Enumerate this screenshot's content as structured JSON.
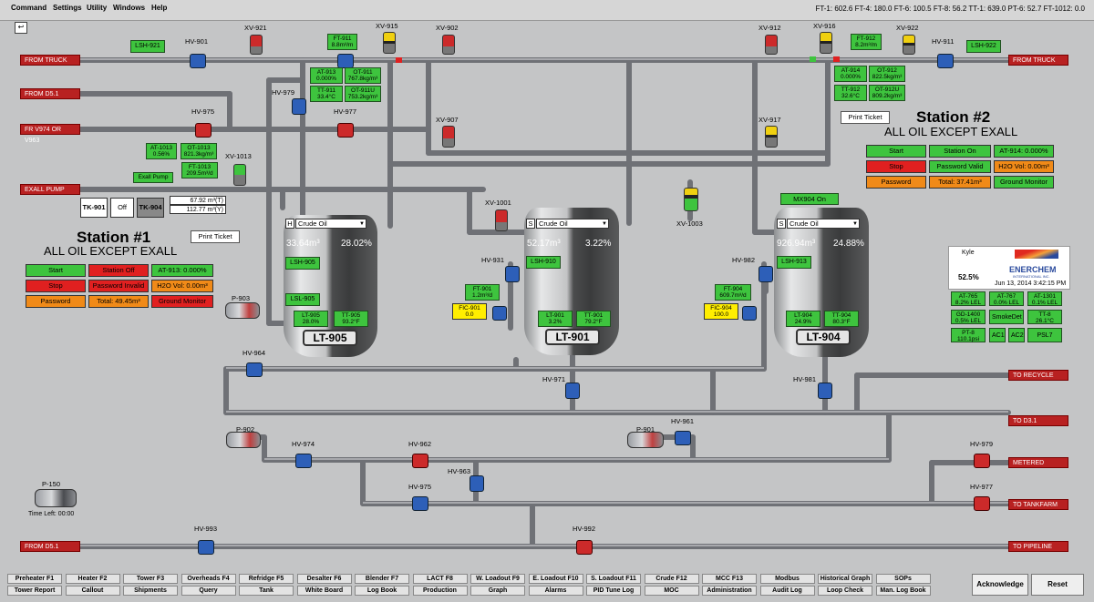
{
  "menu": [
    "Command",
    "Settings",
    "Utility",
    "Windows",
    "Help"
  ],
  "status_readout": "FT-1: 602.6  FT-4: 180.0  FT-6: 100.5  FT-8: 56.2  TT-1: 639.0  PT-6: 52.7  FT-1012: 0.0",
  "lines": {
    "from_truck_left": "FROM TRUCK",
    "from_d51_top": "FROM D5.1",
    "fr_v974": "FR V974 OR V963",
    "exall_pump": "EXALL PUMP",
    "from_truck_right": "FROM TRUCK",
    "to_recycle": "TO RECYCLE",
    "to_d31": "TO D3.1",
    "metered": "METERED",
    "to_tankfarm": "TO TANKFARM",
    "to_pipeline": "TO PIPELINE",
    "from_d51_bottom": "FROM D5.1"
  },
  "valves": {
    "hv901": "HV-901",
    "xv921": "XV-921",
    "xv915": "XV-915",
    "xv902": "XV-902",
    "xv912": "XV-912",
    "xv916": "XV-916",
    "xv922": "XV-922",
    "hv911": "HV-911",
    "hv975a": "HV-975",
    "hv977a": "HV-977",
    "hv979a": "HV-979",
    "xv907": "XV-907",
    "xv917": "XV-917",
    "xv1013": "XV-1013",
    "xv1001": "XV-1001",
    "xv1003": "XV-1003",
    "hv931": "HV-931",
    "hv982": "HV-982",
    "hv964": "HV-964",
    "hv971": "HV-971",
    "hv981": "HV-981",
    "hv974": "HV-974",
    "hv962": "HV-962",
    "hv963": "HV-963",
    "hv975b": "HV-975",
    "hv961": "HV-961",
    "hv979b": "HV-979",
    "hv977b": "HV-977",
    "hv993": "HV-993",
    "hv992": "HV-992"
  },
  "pumps": {
    "p903": "P-903",
    "p902": "P-902",
    "p901": "P-901",
    "p150": "P-150"
  },
  "tags": {
    "lsh921": "LSH-921",
    "ft911": [
      "FT-911",
      "8.8m³/m"
    ],
    "at913": [
      "AT-913",
      "0.000%"
    ],
    "ot911": [
      "OT-911",
      "767.8kg/m³"
    ],
    "tt911": [
      "TT-911",
      "33.4°C"
    ],
    "ot911u": [
      "OT-911U",
      "753.2kg/m³"
    ],
    "ft912": [
      "FT-912",
      "8.2m³/m"
    ],
    "lsh922": "LSH-922",
    "at914": [
      "AT-914",
      "0.000%"
    ],
    "ot912": [
      "OT-912",
      "822.5kg/m³"
    ],
    "tt912": [
      "TT-912",
      "32.6°C"
    ],
    "ot912u": [
      "OT-912U",
      "809.2kg/m³"
    ],
    "at1013": [
      "AT-1013",
      "0.56%"
    ],
    "ot1013": [
      "OT-1013",
      "821.3kg/m³"
    ],
    "ft1013": [
      "FT-1013",
      "209.5m³/d"
    ],
    "exall_pump_btn": "Exall Pump",
    "ft1013_t": "67.92 m³(T)",
    "ft1013_y": "112.77 m³(Y)",
    "lsh905": "LSH-905",
    "lsl905": "LSL-905",
    "lt905": [
      "LT-905",
      "28.0%"
    ],
    "tt905": [
      "TT-905",
      "93.2°F"
    ],
    "lsh910": "LSH-910",
    "ft901": [
      "FT-901",
      "1.2m³/d"
    ],
    "fic901": [
      "FIC-901",
      "0.0"
    ],
    "lt901": [
      "LT-901",
      "3.2%"
    ],
    "tt901": [
      "TT-901",
      "79.2°F"
    ],
    "lsh913": "LSH-913",
    "ft904": [
      "FT-904",
      "609.7m³/d"
    ],
    "fic904": [
      "FIC-904",
      "100.0"
    ],
    "lt904": [
      "LT-904",
      "24.9%"
    ],
    "tt904": [
      "TT-904",
      "80.3°F"
    ]
  },
  "station1": {
    "title": "Station #1",
    "subtitle": "ALL OIL EXCEPT EXALL",
    "tk901": "TK-901",
    "off": "Off",
    "tk904": "TK-904",
    "print": "Print Ticket",
    "start": "Start",
    "station_off": "Station Off",
    "at913": "AT-913: 0.000%",
    "stop": "Stop",
    "password_invalid": "Password Invalid",
    "h2o": "H2O Vol: 0.00m³",
    "password": "Password",
    "total": "Total: 49.45m³",
    "ground_monitor": "Ground Monitor"
  },
  "station2": {
    "title": "Station #2",
    "subtitle": "ALL OIL EXCEPT EXALL",
    "print": "Print Ticket",
    "start": "Start",
    "station_on": "Station On",
    "at914": "AT-914: 0.000%",
    "stop": "Stop",
    "password_valid": "Password Valid",
    "h2o": "H2O Vol: 0.00m³",
    "password": "Password",
    "total": "Total: 37.41m³",
    "ground_monitor": "Ground Monitor"
  },
  "tanks": {
    "lt905": {
      "tag": "LT-905",
      "mode": "H",
      "product": "Crude Oil",
      "volume": "33.64m³",
      "level": "28.02%",
      "level_value": 28.02
    },
    "lt901": {
      "tag": "LT-901",
      "mode": "S",
      "product": "Crude Oil",
      "volume": "52.17m³",
      "level": "3.22%",
      "level_value": 3.22
    },
    "lt904": {
      "tag": "LT-904",
      "mode": "S",
      "product": "Crude Oil",
      "volume": "926.94m³",
      "level": "24.88%",
      "level_value": 24.88,
      "mixer": "MX904 On"
    }
  },
  "info": {
    "user": "Kyle",
    "percent": "52.5%",
    "date": "Jun 13, 2014 3:42:15 PM",
    "logo": "ENERCHEM",
    "logo_sub": "INTERNATIONAL INC."
  },
  "analyzers": [
    [
      "AT-765",
      "8.2% LEL"
    ],
    [
      "AT-767",
      "0.0% LEL"
    ],
    [
      "AT-1301",
      "0.1% LEL"
    ],
    [
      "GD-1400",
      "0.5% LEL"
    ],
    [
      "SmokeDet",
      ""
    ],
    [
      "TT-8",
      "26.1°C"
    ],
    [
      "PT-8",
      "110.1psi"
    ],
    [
      "AC1",
      ""
    ],
    [
      "AC2",
      ""
    ],
    [
      "PSL7",
      ""
    ]
  ],
  "p150_time": "Time Left: 00:00",
  "footer_row1": [
    "Preheater F1",
    "Heater F2",
    "Tower F3",
    "Overheads F4",
    "Refridge F5",
    "Desalter F6",
    "Blender F7",
    "LACT F8",
    "W. Loadout F9",
    "E. Loadout F10",
    "S. Loadout F11",
    "Crude F12",
    "MCC F13",
    "Modbus",
    "Historical Graph",
    "SOPs"
  ],
  "footer_row2": [
    "Tower Report",
    "Callout",
    "Shipments",
    "Query",
    "Tank",
    "White Board",
    "Log Book",
    "Production",
    "Graph",
    "Alarms",
    "PID Tune Log",
    "MOC",
    "Administration",
    "Audit Log",
    "Loop Check",
    "Man. Log Book"
  ],
  "acknowledge": "Acknowledge",
  "reset": "Reset"
}
